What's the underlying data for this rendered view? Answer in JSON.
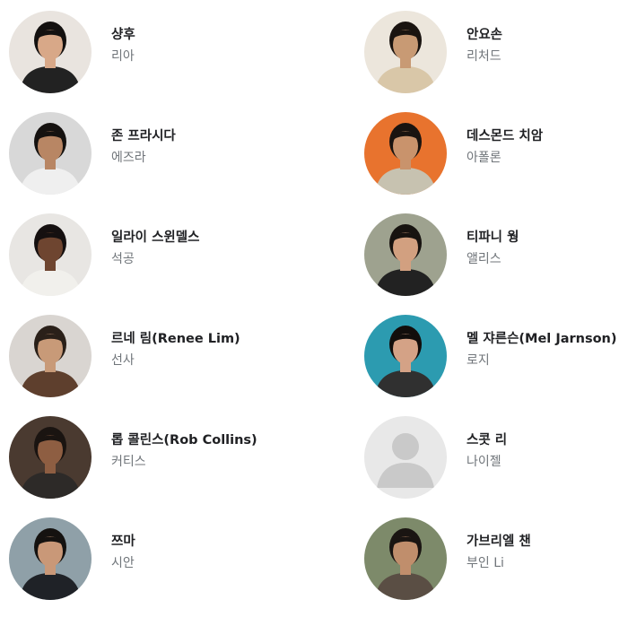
{
  "cast": [
    {
      "actor": "샹후",
      "character": "리아",
      "icon": "portrait-photo",
      "colors": {
        "bg": "#e9e4df",
        "skin": "#d8a888",
        "hair": "#141110",
        "cloth": "#222222"
      }
    },
    {
      "actor": "안요손",
      "character": "리처드",
      "icon": "portrait-photo",
      "colors": {
        "bg": "#ece6dc",
        "skin": "#c89a74",
        "hair": "#1a1410",
        "cloth": "#d9c7a8"
      }
    },
    {
      "actor": "존 프라시다",
      "character": "에즈라",
      "icon": "portrait-photo",
      "colors": {
        "bg": "#d8d8d8",
        "skin": "#b88664",
        "hair": "#151210",
        "cloth": "#efefef"
      }
    },
    {
      "actor": "데스몬드 치암",
      "character": "아폴론",
      "icon": "portrait-photo",
      "colors": {
        "bg": "#e8732e",
        "skin": "#c9936c",
        "hair": "#1a1410",
        "cloth": "#c7c2b0"
      }
    },
    {
      "actor": "일라이 스윈델스",
      "character": "석공",
      "icon": "portrait-photo",
      "colors": {
        "bg": "#e8e6e3",
        "skin": "#6e4530",
        "hair": "#151010",
        "cloth": "#f1f0ec"
      }
    },
    {
      "actor": "티파니 웡",
      "character": "앨리스",
      "icon": "portrait-photo",
      "colors": {
        "bg": "#9ea28f",
        "skin": "#d2a080",
        "hair": "#171310",
        "cloth": "#222222"
      }
    },
    {
      "actor": "르네 림(Renee Lim)",
      "character": "선사",
      "icon": "portrait-photo",
      "colors": {
        "bg": "#d9d5d1",
        "skin": "#c89a78",
        "hair": "#2a2019",
        "cloth": "#5e3f2d"
      }
    },
    {
      "actor": "멜 쟈른슨(Mel Jarnson)",
      "character": "로지",
      "icon": "portrait-photo",
      "colors": {
        "bg": "#2c9bb0",
        "skin": "#d4a286",
        "hair": "#120e0c",
        "cloth": "#303030"
      }
    },
    {
      "actor": "롭 콜린스(Rob Collins)",
      "character": "커티스",
      "icon": "portrait-photo",
      "colors": {
        "bg": "#4a3a30",
        "skin": "#8e5e42",
        "hair": "#1a1411",
        "cloth": "#2d2a28"
      }
    },
    {
      "actor": "스콧 리",
      "character": "나이젤",
      "icon": "person-placeholder-icon",
      "colors": {
        "bg": "#e8e8e8",
        "skin": "#c9c9c9",
        "hair": "#c9c9c9",
        "cloth": "#c9c9c9"
      }
    },
    {
      "actor": "쯔마",
      "character": "시안",
      "icon": "portrait-photo",
      "colors": {
        "bg": "#8fa0a8",
        "skin": "#c99878",
        "hair": "#151210",
        "cloth": "#1f2227"
      }
    },
    {
      "actor": "가브리엘 챈",
      "character": "부인 Li",
      "icon": "portrait-photo",
      "colors": {
        "bg": "#7d8a6a",
        "skin": "#c08e6c",
        "hair": "#1a1512",
        "cloth": "#5a4e44"
      }
    }
  ]
}
